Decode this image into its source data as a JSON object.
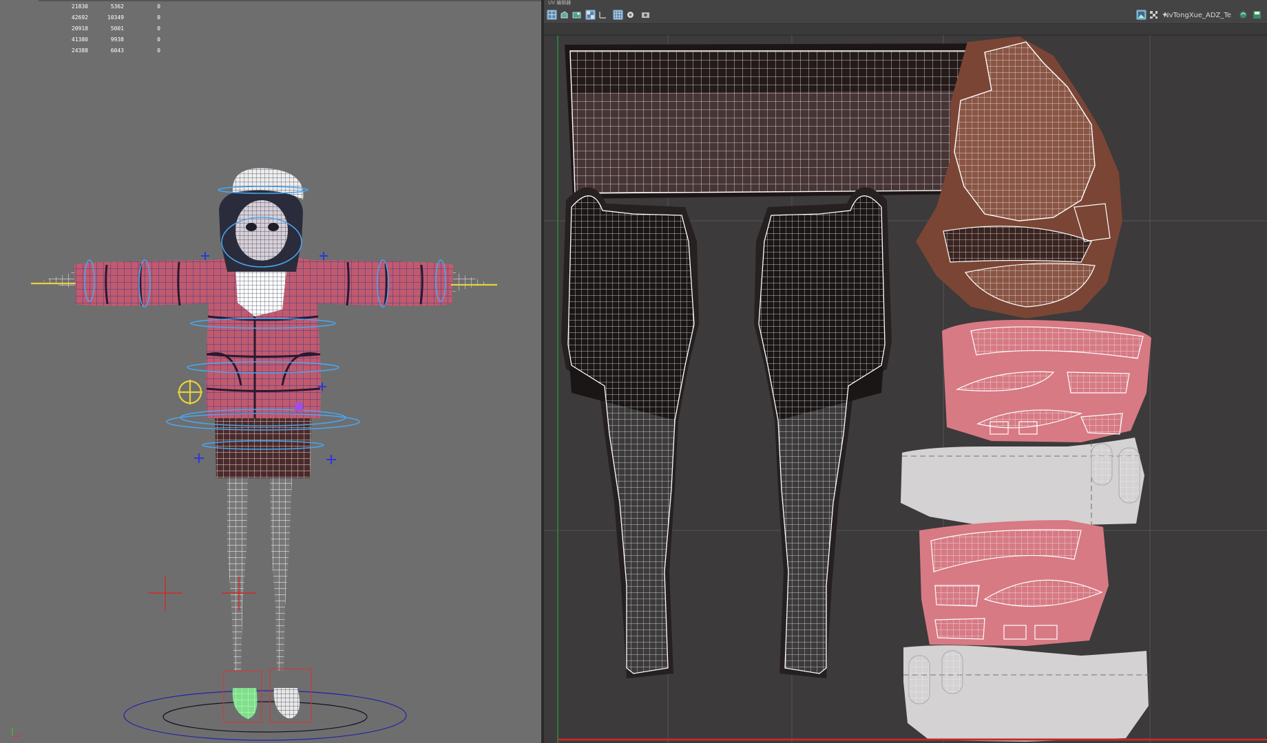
{
  "viewport": {
    "stats_rows": [
      {
        "a": "21830",
        "b": "5362",
        "c": "0"
      },
      {
        "a": "42692",
        "b": "10349",
        "c": "0"
      },
      {
        "a": "20918",
        "b": "5001",
        "c": "0"
      },
      {
        "a": "41380",
        "b": "9938",
        "c": "0"
      },
      {
        "a": "24388",
        "b": "6043",
        "c": "0"
      }
    ]
  },
  "uv_editor": {
    "title": "UV 编辑器",
    "texture_name": "NvTongXue_ADZ_Te",
    "toolbar_icons": [
      "grid-icon",
      "uv-shell-icon",
      "texture-icon",
      "checker-icon",
      "snap-icon",
      "pixel-snap-icon",
      "shaded-icon",
      "camera-icon"
    ],
    "right_icons": [
      "image-icon",
      "checker-display-icon",
      "dropdown-arrow-icon",
      "sync-icon",
      "save-icon"
    ]
  },
  "colors": {
    "viewport_bg": "#6e6e6e",
    "uv_bg": "#3c3a3b",
    "jacket": "#c25a6e",
    "brown_shell": "#7a4535",
    "pink_shell": "#d77a84",
    "white_shell": "#d4d2d2",
    "dark_shell": "#221918",
    "active_tool": "#5b86a8"
  }
}
